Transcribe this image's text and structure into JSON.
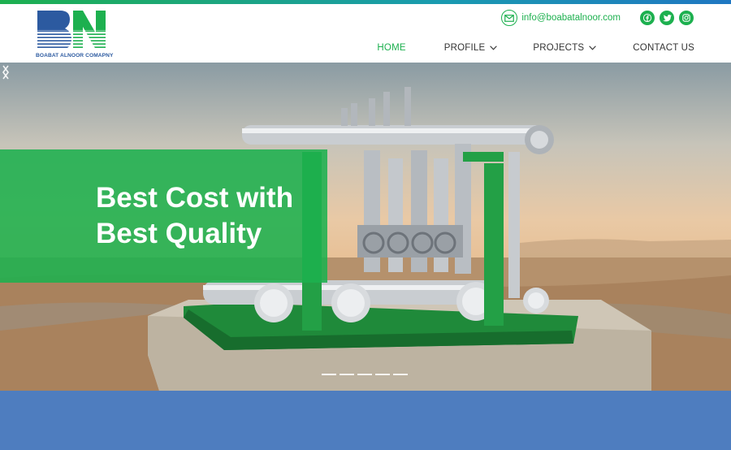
{
  "brand": {
    "logo_letters": "BN",
    "company_name": "BOABAT ALNOOR COMAPNY",
    "colors": {
      "green": "#1db04f",
      "blue": "#2c5aa0",
      "band": "#4e7dbf"
    }
  },
  "contact": {
    "email": "info@boabatalnoor.com",
    "icon": "mail-icon"
  },
  "social": [
    {
      "name": "facebook",
      "icon": "facebook-icon"
    },
    {
      "name": "twitter",
      "icon": "twitter-icon"
    },
    {
      "name": "instagram",
      "icon": "instagram-icon"
    }
  ],
  "nav": {
    "items": [
      {
        "label": "HOME",
        "active": true
      },
      {
        "label": "PROFILE",
        "dropdown": true
      },
      {
        "label": "PROJECTS",
        "dropdown": true
      },
      {
        "label": "CONTACT US"
      }
    ]
  },
  "hero": {
    "line1": "Best Cost with",
    "line2": "Best Quality",
    "slide_count": 5,
    "active_slide": 1
  }
}
